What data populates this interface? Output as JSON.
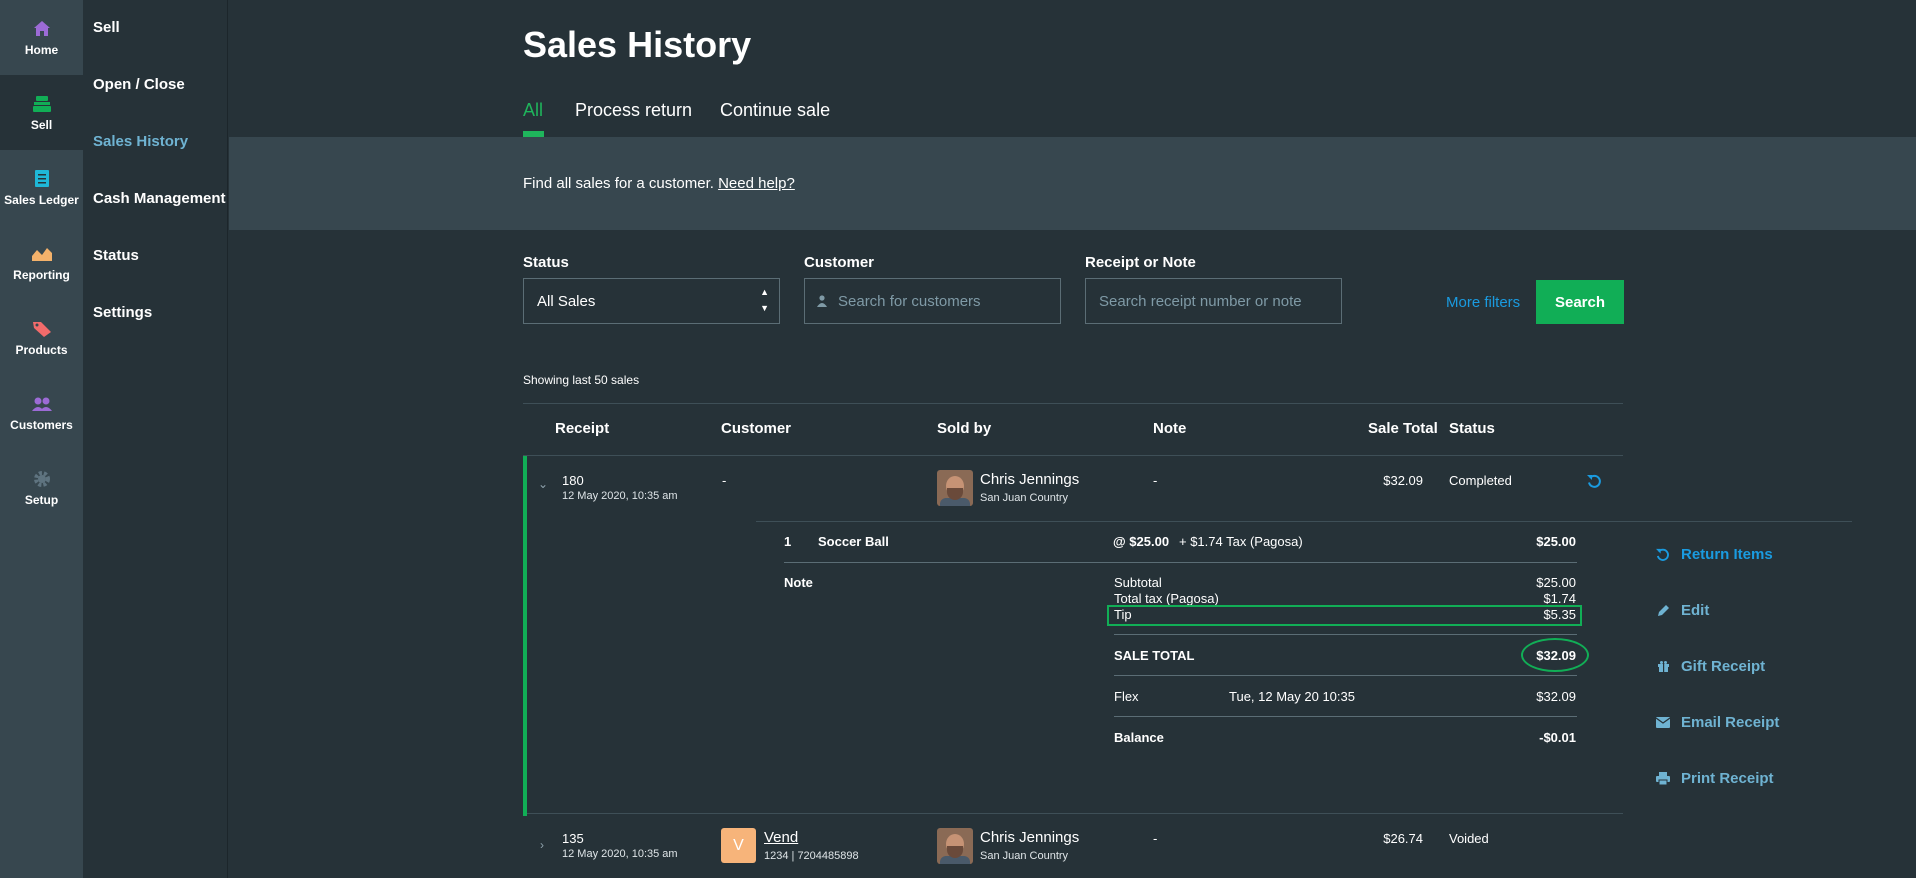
{
  "rail": [
    {
      "label": "Home",
      "icon": "home-icon",
      "color": "#9c6bd6"
    },
    {
      "label": "Sell",
      "icon": "register-icon",
      "color": "#11ae56",
      "active": true
    },
    {
      "label": "Sales Ledger",
      "icon": "ledger-icon",
      "color": "#1fb8d8"
    },
    {
      "label": "Reporting",
      "icon": "chart-icon",
      "color": "#f4b26b"
    },
    {
      "label": "Products",
      "icon": "tag-icon",
      "color": "#f26b6b"
    },
    {
      "label": "Customers",
      "icon": "people-icon",
      "color": "#9c6bd6"
    },
    {
      "label": "Setup",
      "icon": "gear-icon",
      "color": "#5f7480"
    }
  ],
  "submenu": [
    "Sell",
    "Open / Close",
    "Sales History",
    "Cash Management",
    "Status",
    "Settings"
  ],
  "page": {
    "title": "Sales History",
    "tabs": [
      "All",
      "Process return",
      "Continue sale"
    ]
  },
  "help": {
    "text": "Find all sales for a customer. ",
    "link": "Need help?"
  },
  "filters": {
    "status_label": "Status",
    "status_value": "All Sales",
    "customer_label": "Customer",
    "customer_placeholder": "Search for customers",
    "receipt_label": "Receipt or Note",
    "receipt_placeholder": "Search receipt number or note",
    "more_filters": "More filters",
    "search_button": "Search"
  },
  "list": {
    "showing": "Showing last 50 sales",
    "headers": {
      "receipt": "Receipt",
      "customer": "Customer",
      "sold_by": "Sold by",
      "note": "Note",
      "sale_total": "Sale Total",
      "status": "Status"
    }
  },
  "sales": [
    {
      "receipt": "180",
      "date": "12 May 2020, 10:35 am",
      "customer": "-",
      "seller": "Chris Jennings",
      "outlet": "San Juan Country",
      "note": "-",
      "total": "$32.09",
      "status": "Completed",
      "details": {
        "line_qty": "1",
        "line_item": "Soccer Ball",
        "line_price": "@ $25.00",
        "line_tax": "+ $1.74 Tax (Pagosa)",
        "line_total": "$25.00",
        "note_label": "Note",
        "subtotal_label": "Subtotal",
        "subtotal": "$25.00",
        "tax_label": "Total tax (Pagosa)",
        "tax": "$1.74",
        "tip_label": "Tip",
        "tip": "$5.35",
        "sale_total_label": "SALE TOTAL",
        "sale_total": "$32.09",
        "payment_method": "Flex",
        "payment_date": "Tue, 12 May 20 10:35",
        "payment_amount": "$32.09",
        "balance_label": "Balance",
        "balance": "-$0.01"
      },
      "actions": [
        "Return Items",
        "Edit",
        "Gift Receipt",
        "Email Receipt",
        "Print Receipt"
      ]
    },
    {
      "receipt": "135",
      "date": "12 May 2020, 10:35 am",
      "customer_initial": "V",
      "customer": "Vend",
      "customer_sub": "1234 | 7204485898",
      "seller": "Chris Jennings",
      "outlet": "San Juan Country",
      "note": "-",
      "total": "$26.74",
      "status": "Voided"
    }
  ]
}
